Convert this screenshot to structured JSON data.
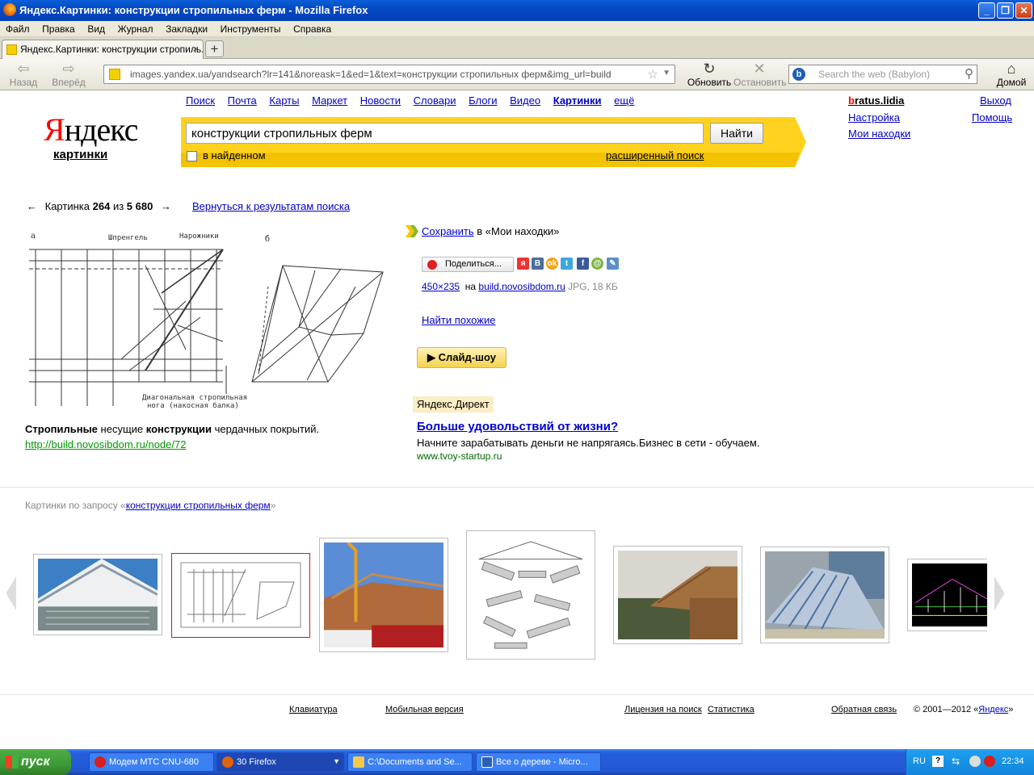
{
  "window": {
    "title": "Яндекс.Картинки: конструкции стропильных ферм - Mozilla Firefox",
    "minimize": "_",
    "maximize": "❐",
    "close": "✕"
  },
  "menu": [
    "Файл",
    "Правка",
    "Вид",
    "Журнал",
    "Закладки",
    "Инструменты",
    "Справка"
  ],
  "tab": {
    "title": "Яндекс.Картинки: конструкции стропиль...",
    "close": "×",
    "new": "+"
  },
  "nav": {
    "back": "Назад",
    "forward": "Вперёд",
    "reload": "Обновить",
    "stop": "Остановить",
    "home": "Домой",
    "url": "images.yandex.ua/yandsearch?lr=141&noreask=1&ed=1&text=конструкции стропильных ферм&img_url=build",
    "search_placeholder": "Search the web (Babylon)"
  },
  "yandex": {
    "logo_red": "Я",
    "logo_rest": "ндекс",
    "logo_sub": "картинки",
    "topnav": [
      "Поиск",
      "Почта",
      "Карты",
      "Маркет",
      "Новости",
      "Словари",
      "Блоги",
      "Видео",
      "Картинки",
      "ещё"
    ],
    "topnav_current": "Картинки",
    "query": "конструкции стропильных ферм",
    "find_button": "Найти",
    "in_found": "в найденном",
    "advanced": "расширенный поиск",
    "user_first": "b",
    "user_rest": "ratus.lidia",
    "logout": "Выход",
    "settings": "Настройка",
    "help": "Помощь",
    "my_finds": "Мои находки"
  },
  "viewer": {
    "prev_arrow": "←",
    "next_arrow": "→",
    "counter_prefix": "Картинка",
    "current": "264",
    "of": "из",
    "total": "5 680",
    "back_to_results": "Вернуться к результатам поиска",
    "image_labels": {
      "a": "а",
      "b": "б",
      "shprengel": "Шпренгель",
      "narozhniki": "Нарожники",
      "diag1": "Диагональная стропильная",
      "diag2": "нога (накосная балка)"
    },
    "caption_b1": "Стропильные",
    "caption_t1": " несущие ",
    "caption_b2": "конструкции",
    "caption_t2": " чердачных покрытий.",
    "source_url": "http://build.novosibdom.ru/node/72",
    "save_link": "Сохранить",
    "save_rest": "в «Мои находки»",
    "share": "Поделиться...",
    "size": "450×235",
    "on": "на",
    "site": "build.novosibdom.ru",
    "meta": "JPG, 18 КБ",
    "find_similar": "Найти похожие",
    "slideshow": "▶ Слайд-шоу"
  },
  "ad": {
    "label": "Яндекс.Директ",
    "title": "Больше удовольствий от жизни?",
    "text": "Начните зарабатывать деньги не напрягаясь.Бизнес в сети - обучаем.",
    "url": "www.tvoy-startup.ru"
  },
  "related": {
    "prefix": "Картинки по запросу «",
    "query": "конструкции стропильных ферм",
    "suffix": "»"
  },
  "footer": {
    "keyboard": "Клавиатура",
    "mobile": "Мобильная версия",
    "license": "Лицензия на поиск",
    "stats": "Статистика",
    "feedback": "Обратная связь",
    "copyright": "© 2001—2012 «",
    "copyright_link": "Яндекс",
    "copyright_end": "»"
  },
  "taskbar": {
    "start": "пуск",
    "tasks": [
      "Модем МТС CNU-680",
      "30 Firefox",
      "C:\\Documents and Se...",
      "Все о дереве - Micro..."
    ],
    "lang": "RU",
    "clock": "22:34"
  }
}
